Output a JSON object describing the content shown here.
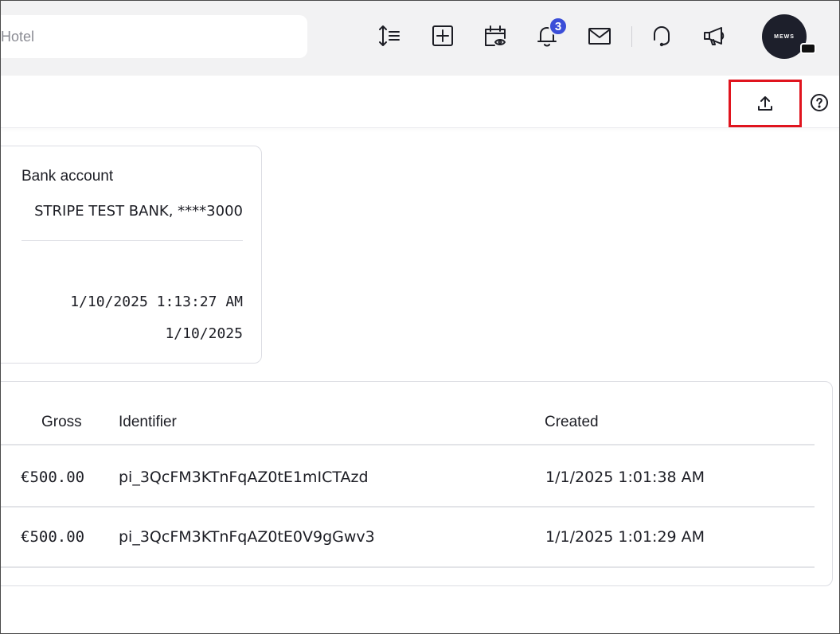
{
  "topbar": {
    "search_placeholder": "Hotel",
    "notification_count": "3",
    "avatar_text": "MEWS"
  },
  "card": {
    "bank_account_label": "Bank account",
    "bank_account_value": "STRIPE TEST BANK, ****3000",
    "datetime_value": "1/10/2025 1:13:27 AM",
    "date_value": "1/10/2025"
  },
  "table": {
    "headers": {
      "gross": "Gross",
      "identifier": "Identifier",
      "created": "Created"
    },
    "rows": [
      {
        "gross": "€500.00",
        "identifier": "pi_3QcFM3KTnFqAZ0tE1mICTAzd",
        "created": "1/1/2025 1:01:38 AM"
      },
      {
        "gross": "€500.00",
        "identifier": "pi_3QcFM3KTnFqAZ0tE0V9gGwv3",
        "created": "1/1/2025 1:01:29 AM"
      }
    ]
  },
  "colors": {
    "accent_badge": "#3b4ed8",
    "highlight_border": "#e0141e"
  }
}
